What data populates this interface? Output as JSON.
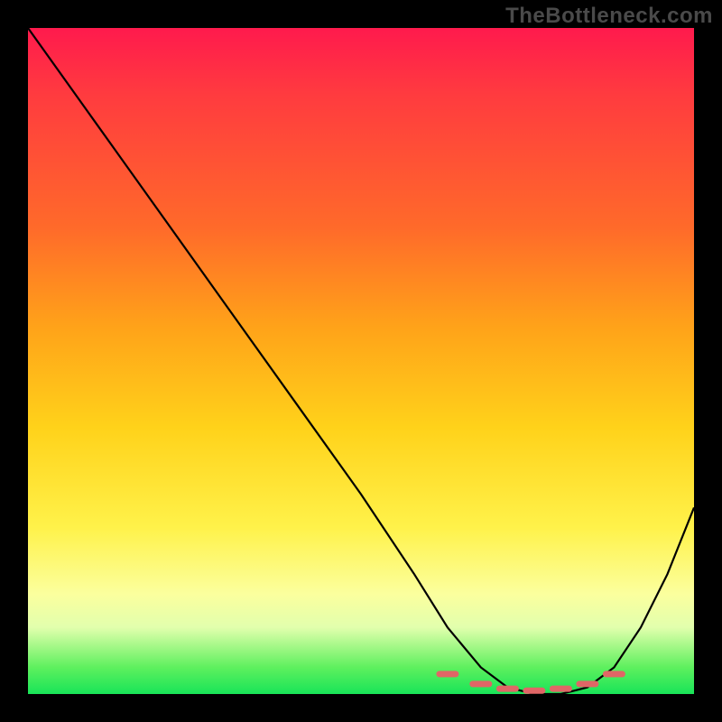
{
  "watermark": "TheBottleneck.com",
  "chart_data": {
    "type": "line",
    "title": "",
    "xlabel": "",
    "ylabel": "",
    "xlim": [
      0,
      100
    ],
    "ylim": [
      0,
      100
    ],
    "series": [
      {
        "name": "curve",
        "x": [
          0,
          10,
          20,
          30,
          40,
          50,
          58,
          63,
          68,
          72,
          76,
          80,
          84,
          88,
          92,
          96,
          100
        ],
        "values": [
          100,
          86,
          72,
          58,
          44,
          30,
          18,
          10,
          4,
          1,
          0,
          0,
          1,
          4,
          10,
          18,
          28
        ]
      }
    ],
    "markers": {
      "name": "red-dots",
      "x": [
        63,
        68,
        72,
        76,
        80,
        84,
        88
      ],
      "values": [
        3.0,
        1.5,
        0.8,
        0.5,
        0.8,
        1.5,
        3.0
      ]
    },
    "gradient_stops": [
      {
        "pos": 0.0,
        "color": "#ff1a4d"
      },
      {
        "pos": 0.3,
        "color": "#ff6a2a"
      },
      {
        "pos": 0.6,
        "color": "#ffd21a"
      },
      {
        "pos": 0.85,
        "color": "#fbff9e"
      },
      {
        "pos": 1.0,
        "color": "#18e458"
      }
    ]
  }
}
